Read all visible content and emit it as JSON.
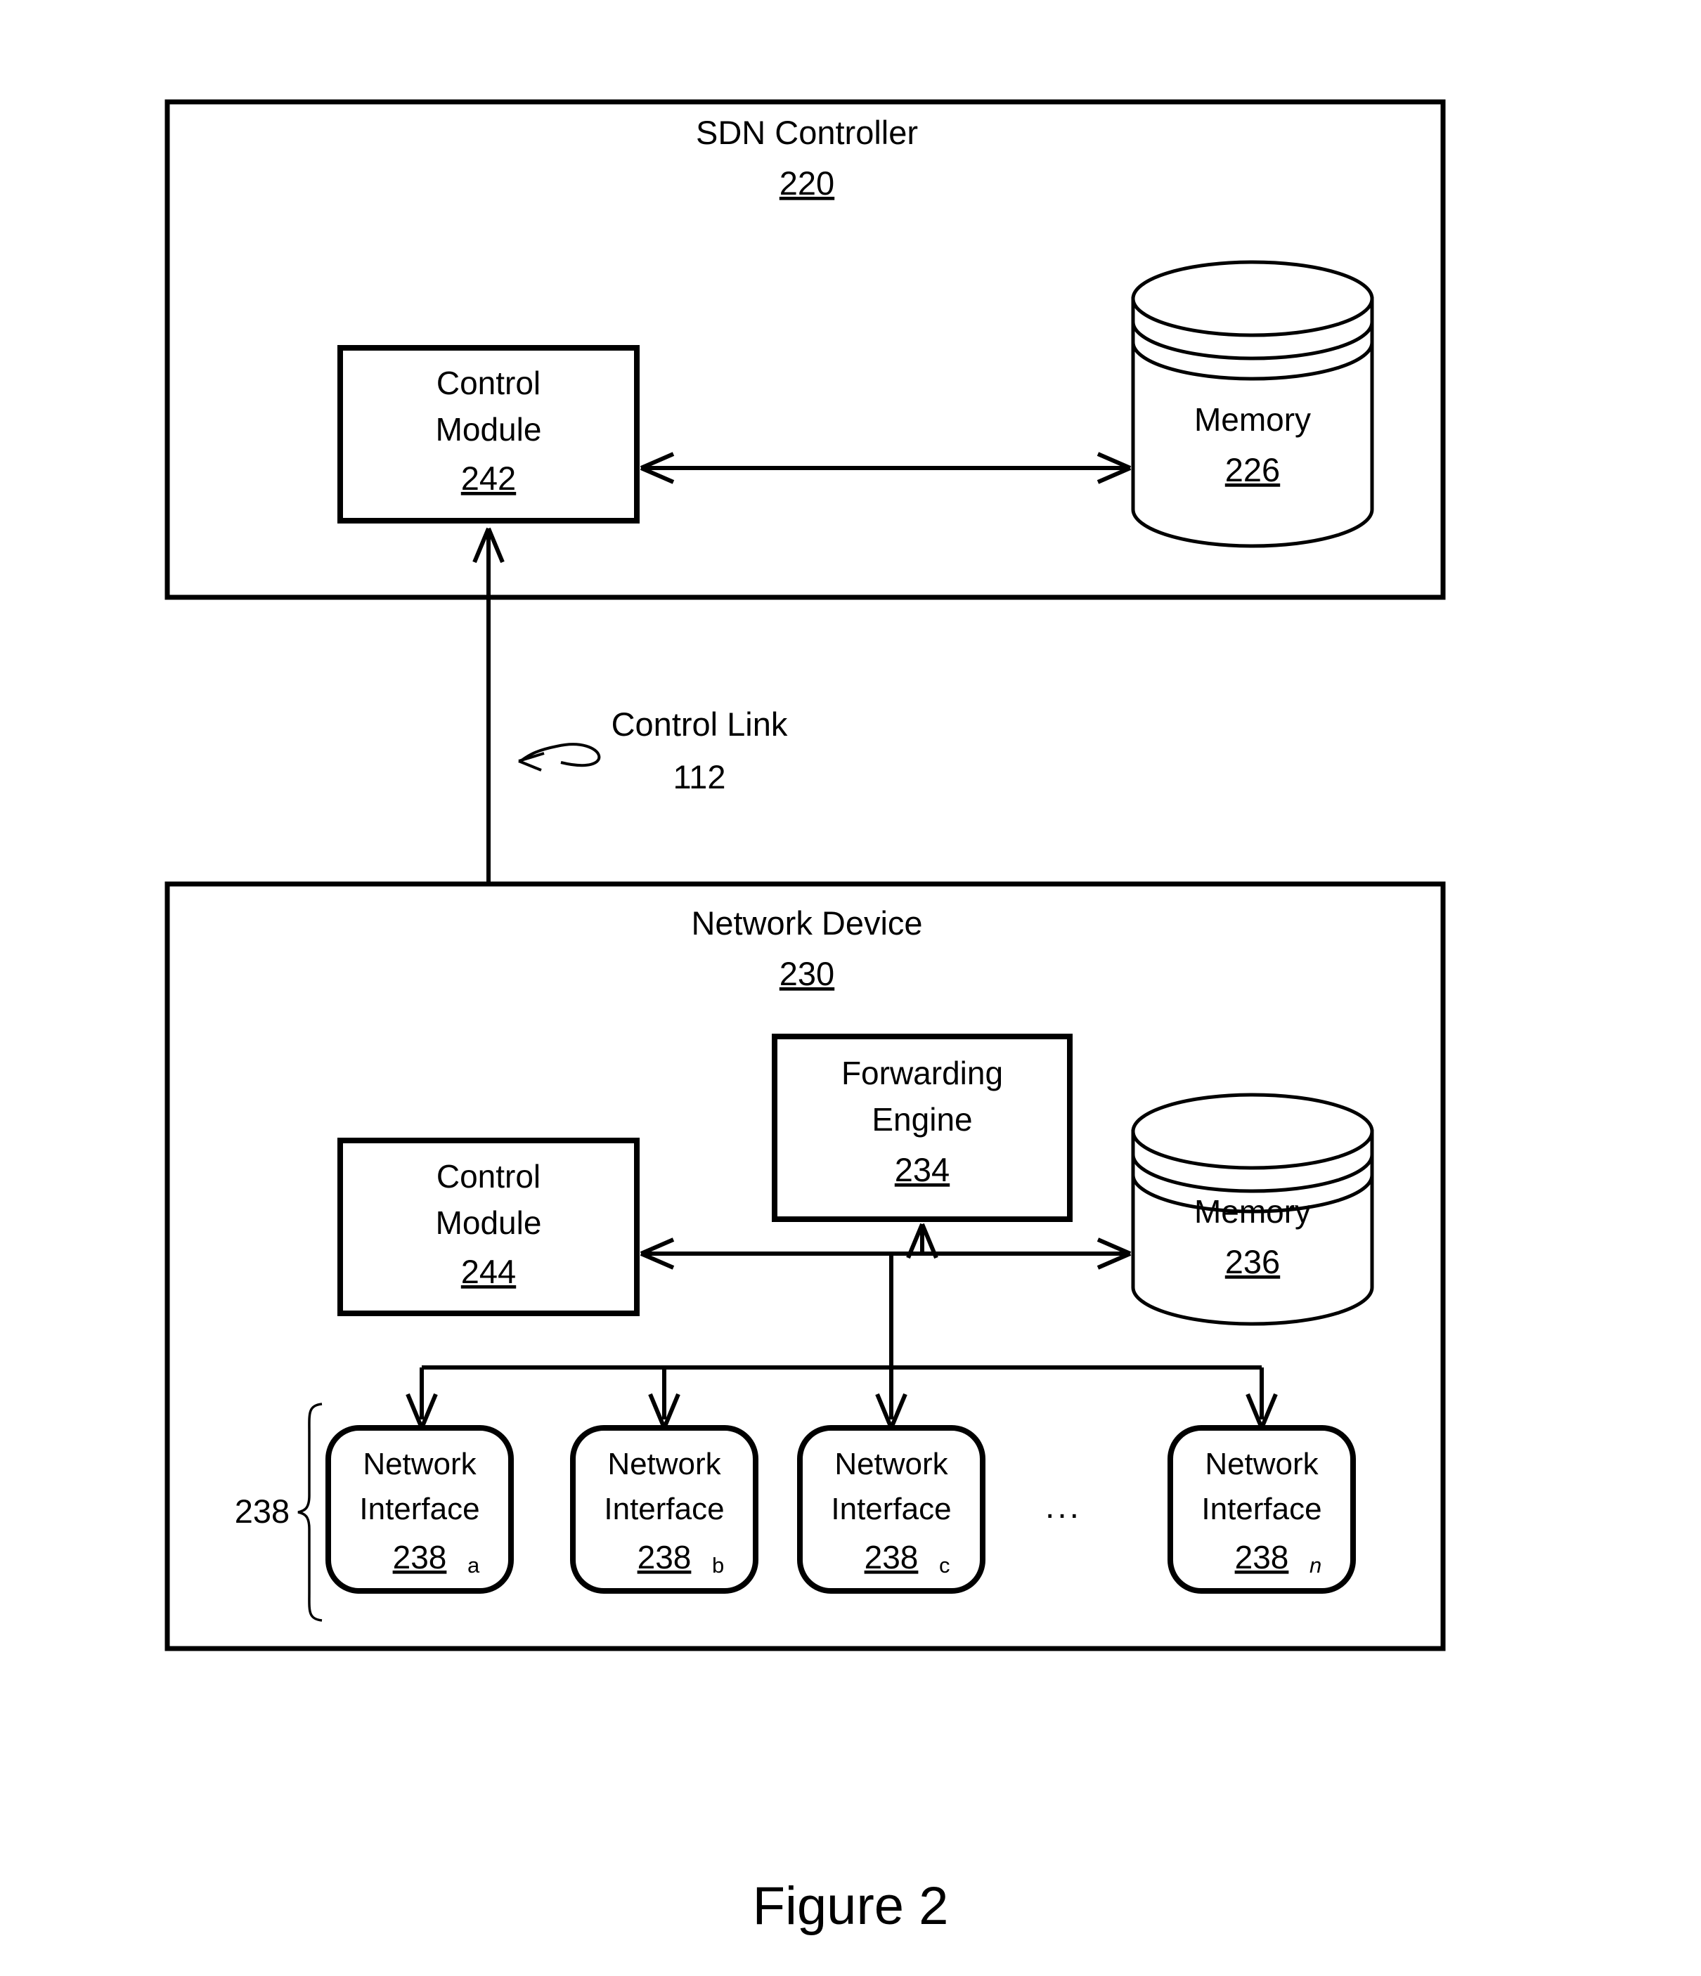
{
  "figure": {
    "caption": "Figure 2"
  },
  "sdn_controller": {
    "title": "SDN Controller",
    "ref": "220",
    "control_module": {
      "line1": "Control",
      "line2": "Module",
      "ref": "242"
    },
    "memory": {
      "label": "Memory",
      "ref": "226"
    }
  },
  "control_link": {
    "label": "Control Link",
    "ref": "112"
  },
  "network_device": {
    "title": "Network Device",
    "ref": "230",
    "control_module": {
      "line1": "Control",
      "line2": "Module",
      "ref": "244"
    },
    "forwarding_engine": {
      "line1": "Forwarding",
      "line2": "Engine",
      "ref": "234"
    },
    "memory": {
      "label": "Memory",
      "ref": "236"
    },
    "interfaces_group_ref": "238",
    "ellipsis": "...",
    "interfaces": [
      {
        "line1": "Network",
        "line2": "Interface",
        "ref": "238",
        "sub": "a",
        "sub_italic": false
      },
      {
        "line1": "Network",
        "line2": "Interface",
        "ref": "238",
        "sub": "b",
        "sub_italic": false
      },
      {
        "line1": "Network",
        "line2": "Interface",
        "ref": "238",
        "sub": "c",
        "sub_italic": false
      },
      {
        "line1": "Network",
        "line2": "Interface",
        "ref": "238",
        "sub": "n",
        "sub_italic": true
      }
    ]
  },
  "colors": {
    "stroke": "#000000",
    "background": "#ffffff"
  }
}
